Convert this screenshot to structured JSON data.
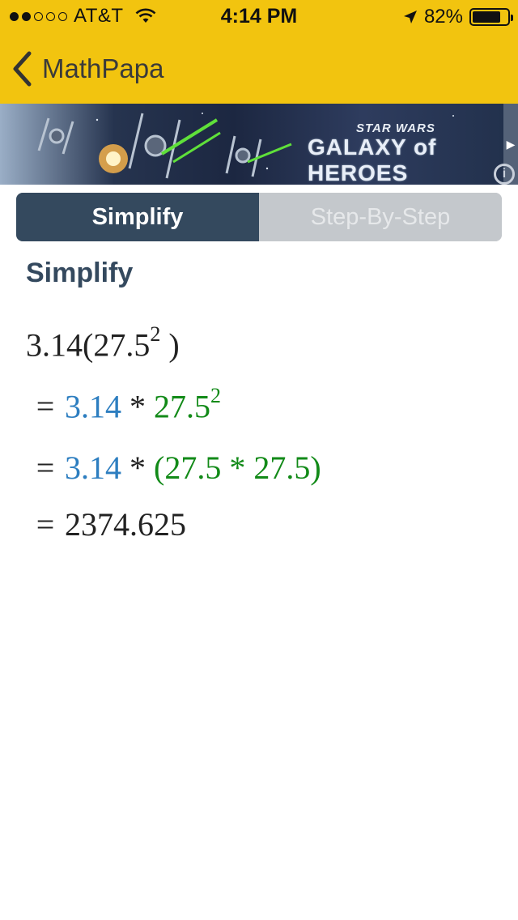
{
  "status_bar": {
    "carrier": "AT&T",
    "signal_bars_filled": 2,
    "signal_bars_total": 5,
    "time": "4:14 PM",
    "battery_percent": "82%",
    "battery_level": 0.82
  },
  "nav": {
    "back_label": "MathPapa"
  },
  "ad": {
    "brand_top": "STAR WARS",
    "brand_main": "GALAXY of HEROES",
    "info_icon": "i",
    "next_icon": "▶"
  },
  "tabs": [
    {
      "label": "Simplify",
      "active": true
    },
    {
      "label": "Step-By-Step",
      "active": false
    }
  ],
  "section_title": "Simplify",
  "expression": {
    "input_base": "3.14(27.5",
    "input_exp": "2",
    "input_close": " )"
  },
  "steps": [
    {
      "equals": "=",
      "a": "3.14",
      "op": " * ",
      "b": "27.5",
      "b_exp": "2"
    },
    {
      "equals": "=",
      "a": "3.14",
      "op": " * ",
      "b": "(27.5 * 27.5)"
    },
    {
      "equals": "=",
      "result": "2374.625"
    }
  ],
  "colors": {
    "header": "#f2c40f",
    "tab_active": "#34495e",
    "tab_inactive": "#c4c8cc",
    "term_blue": "#2d7ec0",
    "term_green": "#128a18"
  }
}
